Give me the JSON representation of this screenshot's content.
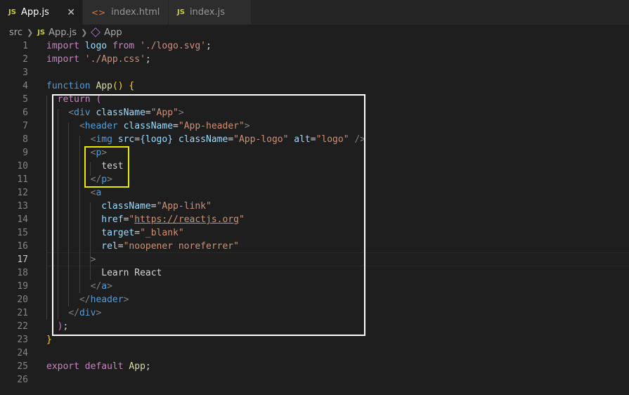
{
  "tabs": [
    {
      "icon": "js-file-icon",
      "label": "App.js",
      "active": true
    },
    {
      "icon": "html-file-icon",
      "label": "index.html",
      "active": false
    },
    {
      "icon": "js-file-icon",
      "label": "index.js",
      "active": false
    }
  ],
  "tab_icon_js": "JS",
  "tab_icon_html": "<>",
  "close_glyph": "✕",
  "breadcrumb": {
    "folder": "src",
    "file": "App.js",
    "symbol": "App"
  },
  "editor": {
    "current_line": 17,
    "line_numbers": [
      "1",
      "2",
      "3",
      "4",
      "5",
      "6",
      "7",
      "8",
      "9",
      "10",
      "11",
      "12",
      "13",
      "14",
      "15",
      "16",
      "17",
      "18",
      "19",
      "20",
      "21",
      "22",
      "23",
      "24",
      "25",
      "26"
    ],
    "lines": {
      "l1": {
        "kw": "import",
        "v": "logo",
        "k2": "from",
        "s": "'./logo.svg'",
        "e": ";"
      },
      "l2": {
        "kw": "import",
        "s": "'./App.css'",
        "e": ";"
      },
      "l4": {
        "kw": "function",
        "fn": "App",
        "p": "()",
        "b": "{"
      },
      "l5": {
        "kw": "return",
        "p": "("
      },
      "l6": {
        "o": "<",
        "t": "div",
        "a": "className",
        "eq": "=",
        "s": "\"App\"",
        "c": ">"
      },
      "l7": {
        "o": "<",
        "t": "header",
        "a": "className",
        "eq": "=",
        "s": "\"App-header\"",
        "c": ">"
      },
      "l8": {
        "o": "<",
        "t": "img",
        "a1": "src",
        "eq1": "=",
        "v1": "{logo}",
        "a2": "className",
        "eq2": "=",
        "s2": "\"App-logo\"",
        "a3": "alt",
        "eq3": "=",
        "s3": "\"logo\"",
        "c": "/>"
      },
      "l9": {
        "o": "<",
        "t": "p",
        "c": ">"
      },
      "l10": {
        "text": "test"
      },
      "l11": {
        "o": "</",
        "t": "p",
        "c": ">"
      },
      "l12": {
        "o": "<",
        "t": "a"
      },
      "l13": {
        "a": "className",
        "eq": "=",
        "s": "\"App-link\""
      },
      "l14": {
        "a": "href",
        "eq": "=",
        "q1": "\"",
        "url": "https://reactjs.org",
        "q2": "\""
      },
      "l15": {
        "a": "target",
        "eq": "=",
        "s": "\"_blank\""
      },
      "l16": {
        "a": "rel",
        "eq": "=",
        "s": "\"noopener noreferrer\""
      },
      "l17": {
        "c": ">"
      },
      "l18": {
        "text": "Learn React"
      },
      "l19": {
        "o": "</",
        "t": "a",
        "c": ">"
      },
      "l20": {
        "o": "</",
        "t": "header",
        "c": ">"
      },
      "l21": {
        "o": "</",
        "t": "div",
        "c": ">"
      },
      "l22": {
        "p": ")",
        "e": ";"
      },
      "l23": {
        "b": "}"
      },
      "l25": {
        "k1": "export",
        "k2": "default",
        "v": "App",
        "e": ";"
      }
    }
  },
  "colors": {
    "highlight_outer": "#ffffff",
    "highlight_inner": "#e8e800",
    "background": "#1e1e1e"
  }
}
